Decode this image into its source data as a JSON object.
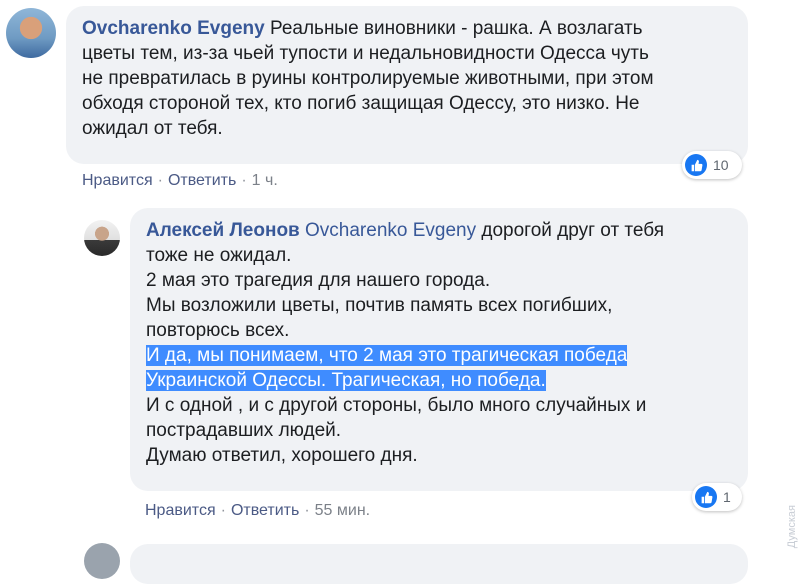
{
  "comments": [
    {
      "author": "Ovcharenko Evgeny",
      "lines": [
        "Реальные виновники - рашка. А возлагать",
        "цветы тем, из-за чьей тупости и недальновидности Одесса чуть",
        "не превратилась в руины контролируемые животными, при этом",
        "обходя стороной тех, кто погиб защищая Одессу, это низко. Не",
        "ожидал от тебя."
      ],
      "like_label": "Нравится",
      "reply_label": "Ответить",
      "time": "1 ч.",
      "reaction_count": "10"
    },
    {
      "author": "Алексей Леонов",
      "mention": "Ovcharenko Evgeny",
      "first_line_rest": "дорогой друг от тебя",
      "lines": [
        "тоже не ожидал.",
        "2 мая это трагедия для нашего города.",
        "Мы возложили цветы, почтив память всех погибших,",
        "повторюсь всех."
      ],
      "highlighted": [
        "И да, мы понимаем, что 2 мая это трагическая победа",
        "Украинской Одессы. Трагическая, но победа."
      ],
      "tail_lines": [
        "И с одной , и с другой стороны, было много случайных и",
        "пострадавших людей.",
        "Думаю ответил, хорошего дня."
      ],
      "like_label": "Нравится",
      "reply_label": "Ответить",
      "time": "55 мин.",
      "reaction_count": "1"
    }
  ],
  "watermark": "Думская",
  "colors": {
    "author": "#385898",
    "bubble": "#f0f2f5",
    "highlight": "#3f8cff",
    "like": "#1877f2"
  }
}
